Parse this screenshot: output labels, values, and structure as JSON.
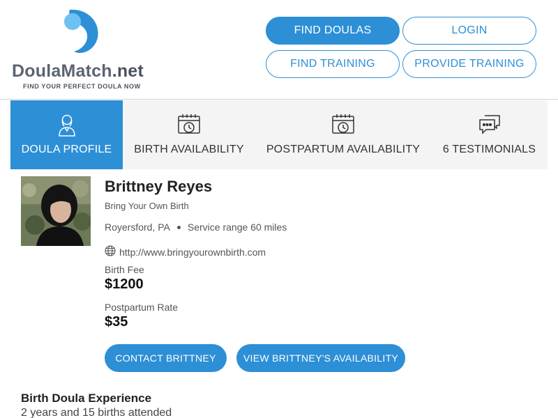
{
  "brand": {
    "name_main": "DoulaMatch",
    "name_suffix": ".net",
    "tagline": "FIND YOUR PERFECT DOULA NOW",
    "color_primary": "#2d8fd6",
    "color_light": "#6ec1f2"
  },
  "nav": {
    "find_doulas": "FIND DOULAS",
    "login": "LOGIN",
    "find_training": "FIND TRAINING",
    "provide_training": "PROVIDE TRAINING"
  },
  "tabs": [
    {
      "label": "DOULA PROFILE",
      "icon": "doula-person-icon",
      "active": true
    },
    {
      "label": "BIRTH AVAILABILITY",
      "icon": "calendar-clock-icon",
      "active": false
    },
    {
      "label": "POSTPARTUM AVAILABILITY",
      "icon": "calendar-clock-icon",
      "active": false
    },
    {
      "label": "6 TESTIMONIALS",
      "icon": "chat-bubbles-icon",
      "active": false
    }
  ],
  "profile": {
    "name": "Brittney Reyes",
    "business": "Bring Your Own Birth",
    "location": "Royersford, PA",
    "service_range": "Service range 60 miles",
    "website": "http://www.bringyourownbirth.com",
    "birth_fee_label": "Birth Fee",
    "birth_fee": "$1200",
    "postpartum_label": "Postpartum Rate",
    "postpartum_rate": "$35",
    "contact_button": "CONTACT BRITTNEY",
    "availability_button": "VIEW BRITTNEY'S AVAILABILITY"
  },
  "experience": {
    "title": "Birth Doula Experience",
    "text": "2 years and 15 births attended"
  }
}
